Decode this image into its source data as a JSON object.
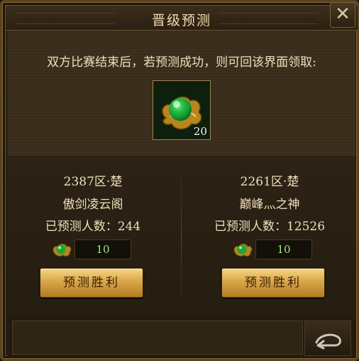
{
  "header": {
    "title": "晋级预测"
  },
  "reward": {
    "description": "双方比赛结束后，若预测成功，则可回该界面领取:",
    "count": "20",
    "icon": "green-gem-icon"
  },
  "teams": [
    {
      "server": "2387区·楚",
      "name": "傲剑凌云阁",
      "count_label": "已预测人数：244",
      "bet": "10",
      "button": "预测胜利"
    },
    {
      "server": "2261区·楚",
      "name": "巅峰灬之神",
      "count_label": "已预测人数：12526",
      "bet": "10",
      "button": "预测胜利"
    }
  ],
  "colors": {
    "accent_gold": "#d9a748",
    "text": "#f1dfbd",
    "bet_green": "#9eea84"
  }
}
